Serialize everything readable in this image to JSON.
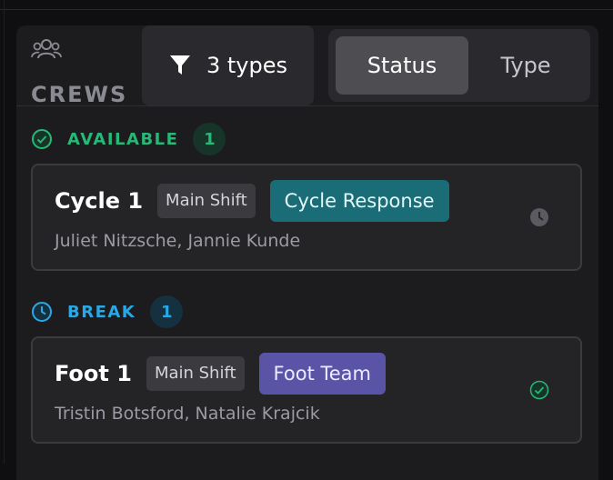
{
  "header": {
    "crews_label": "CREWS",
    "crews_icon": "people-group-icon",
    "filter": {
      "icon": "filter-funnel-icon",
      "label": "3 types"
    },
    "segmented": {
      "options": [
        "Status",
        "Type"
      ],
      "selected": "Status"
    }
  },
  "groups": [
    {
      "name": "AVAILABLE",
      "count": "1",
      "icon": "check-circle-icon",
      "color": "#27b877",
      "crews": [
        {
          "name": "Cycle 1",
          "shift": "Main Shift",
          "type": "Cycle Response",
          "type_color": "#1a6d77",
          "members": "Juliet Nitzsche, Jannie Kunde",
          "status_icon": "clock-icon"
        }
      ]
    },
    {
      "name": "BREAK",
      "count": "1",
      "icon": "clock-icon",
      "color": "#29a8e6",
      "crews": [
        {
          "name": "Foot 1",
          "shift": "Main Shift",
          "type": "Foot Team",
          "type_color": "#5a54a6",
          "members": "Tristin Botsford, Natalie Krajcik",
          "status_icon": "check-circle-icon"
        }
      ]
    }
  ]
}
